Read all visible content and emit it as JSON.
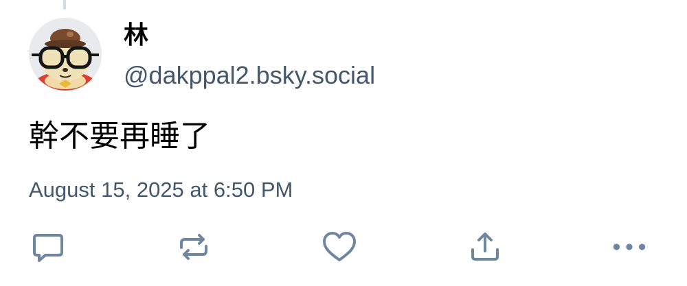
{
  "post": {
    "author": {
      "display_name": "林",
      "handle": "@dakppal2.bsky.social"
    },
    "text": "幹不要再睡了",
    "timestamp": "August 15, 2025 at 6:50 PM"
  },
  "actions": [
    {
      "name": "reply",
      "icon": "comment-icon"
    },
    {
      "name": "repost",
      "icon": "repost-icon"
    },
    {
      "name": "like",
      "icon": "heart-icon"
    },
    {
      "name": "share",
      "icon": "share-icon"
    },
    {
      "name": "more",
      "icon": "ellipsis-icon"
    }
  ],
  "colors": {
    "secondary_text": "#42576c",
    "icon": "#6f869f",
    "thread_line": "#d4dbe2"
  }
}
